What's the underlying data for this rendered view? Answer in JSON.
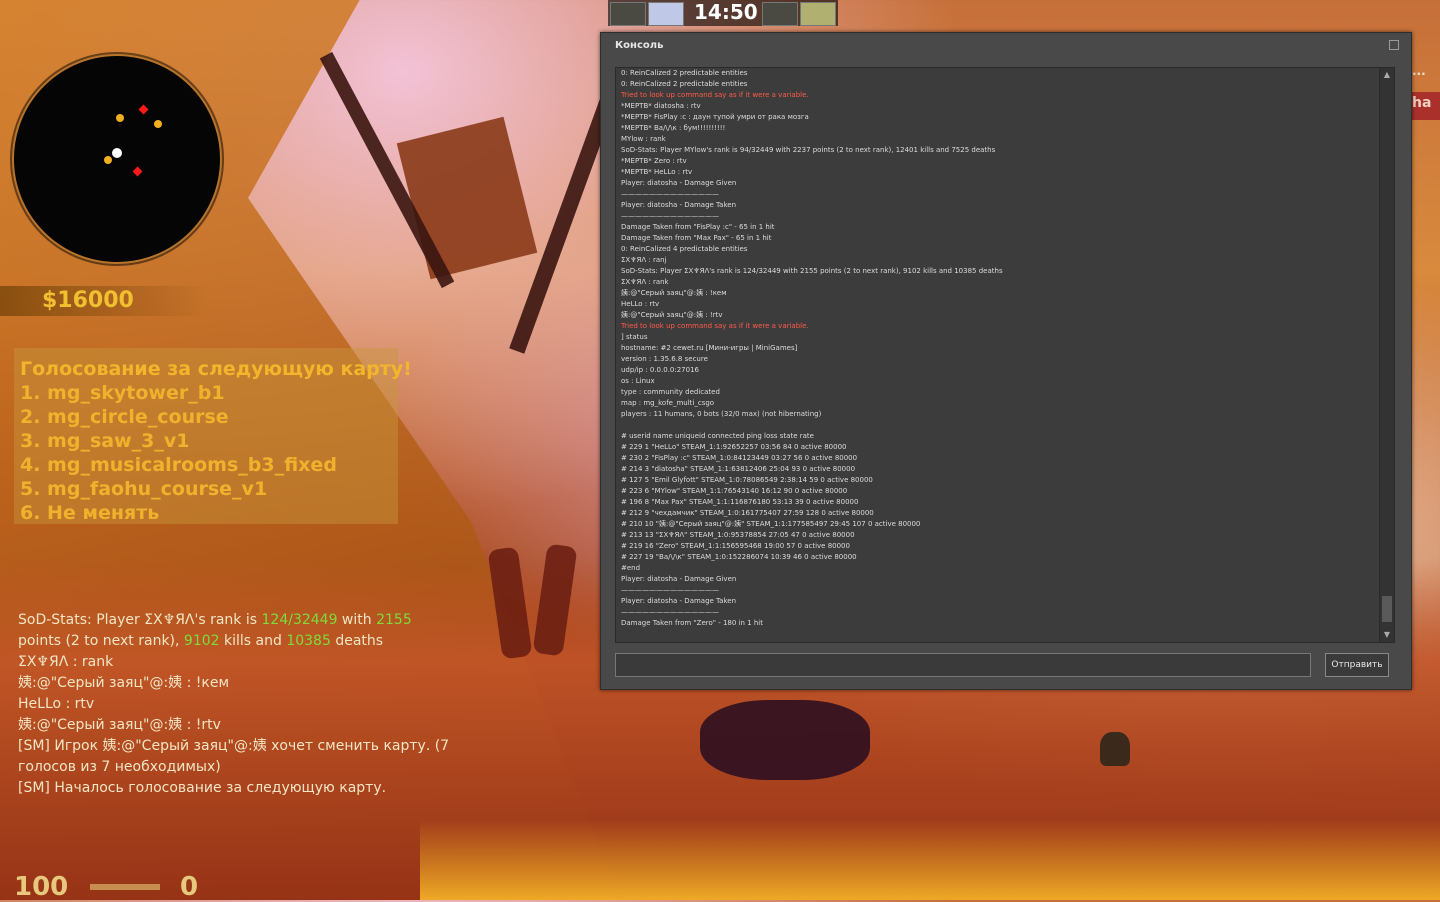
{
  "hud": {
    "money": "$16000",
    "health": "100",
    "armor": "0",
    "clock": "14:50",
    "right_edge_text": "ha",
    "right_edge_dots": "..."
  },
  "vote": {
    "title": "Голосование за следующую карту!",
    "options": [
      "1. mg_skytower_b1",
      "2. mg_circle_course",
      "3. mg_saw_3_v1",
      "4. mg_musicalrooms_b3_fixed",
      "5. mg_faohu_course_v1",
      "6. Не менять"
    ]
  },
  "chat": {
    "line1_a": "SoD-Stats: Player ΣX♆ЯΛ's rank is ",
    "line1_rank": "124/32449",
    "line1_b": " with ",
    "line1_points": "2155",
    "line2_a": "points (2 to next rank), ",
    "line2_kills": "9102",
    "line2_b": " kills and ",
    "line2_deaths": "10385",
    "line2_c": " deaths",
    "line3": "ΣX♆ЯΛ : rank",
    "line4": "姨:@\"Серый заяц\"@:姨 : !кем",
    "line5": "HeLLo : rtv",
    "line6": "姨:@\"Серый заяц\"@:姨 : !rtv",
    "line7": "[SM] Игрок 姨:@\"Серый заяц\"@:姨 хочет сменить карту. (7",
    "line8": "голосов из 7 необходимых)",
    "line9": "[SM] Началось голосование за следующую карту."
  },
  "console": {
    "title": "Консоль",
    "send_label": "Отправить",
    "lines": [
      {
        "t": "0:  ReinCalized 2 predictable entities",
        "err": false
      },
      {
        "t": "0:  ReinCalized 2 predictable entities",
        "err": false
      },
      {
        "t": "Tried to look up command say as if it were a variable.",
        "err": true
      },
      {
        "t": "*МЕРТВ* diatosha : rtv",
        "err": false
      },
      {
        "t": "*МЕРТВ* FisPlay :c : даун тупой умри от рака мозга",
        "err": false
      },
      {
        "t": "*МЕРТВ* Ba/\\/\\к : бум!!!!!!!!!!",
        "err": false
      },
      {
        "t": "MYlow : rank",
        "err": false
      },
      {
        "t": "SoD-Stats: Player MYlow's rank is 94/32449 with 2237 points (2 to next rank), 12401 kills and 7525 deaths",
        "err": false
      },
      {
        "t": "*МЕРТВ* Zero : rtv",
        "err": false
      },
      {
        "t": "*МЕРТВ* HeLLo : rtv",
        "err": false
      },
      {
        "t": "Player: diatosha - Damage Given",
        "err": false
      },
      {
        "t": "——————————————",
        "err": false
      },
      {
        "t": "Player: diatosha - Damage Taken",
        "err": false
      },
      {
        "t": "——————————————",
        "err": false
      },
      {
        "t": "Damage Taken from \"FisPlay :c\" - 65 in 1 hit",
        "err": false
      },
      {
        "t": "Damage Taken from \"Max Pax\" - 65 in 1 hit",
        "err": false
      },
      {
        "t": "0:  ReinCalized 4 predictable entities",
        "err": false
      },
      {
        "t": "ΣX♆ЯΛ : ranj",
        "err": false
      },
      {
        "t": "SoD-Stats: Player ΣX♆ЯΛ's rank is 124/32449 with 2155 points (2 to next rank), 9102 kills and 10385 deaths",
        "err": false
      },
      {
        "t": "ΣX♆ЯΛ : rank",
        "err": false
      },
      {
        "t": "姨:@\"Серый заяц\"@:姨 : !кем",
        "err": false
      },
      {
        "t": "HeLLo : rtv",
        "err": false
      },
      {
        "t": "姨:@\"Серый заяц\"@:姨 : !rtv",
        "err": false
      },
      {
        "t": "Tried to look up command say as if it were a variable.",
        "err": true
      },
      {
        "t": "] status",
        "err": false
      },
      {
        "t": "hostname: #2 cewet.ru [Мини-игры | MiniGames]",
        "err": false
      },
      {
        "t": "version : 1.35.6.8 secure",
        "err": false
      },
      {
        "t": "udp/ip  : 0.0.0.0:27016",
        "err": false
      },
      {
        "t": "os      :  Linux",
        "err": false
      },
      {
        "t": "type    :  community dedicated",
        "err": false
      },
      {
        "t": "map     :  mg_kofe_multi_csgo",
        "err": false
      },
      {
        "t": "players : 11 humans, 0 bots (32/0 max) (not hibernating)",
        "err": false
      },
      {
        "t": "",
        "err": false
      },
      {
        "t": "# userid name uniqueid connected ping loss state rate",
        "err": false
      },
      {
        "t": "# 229 1 \"HeLLo\" STEAM_1:1:92652257 03:56 84 0 active 80000",
        "err": false
      },
      {
        "t": "# 230 2 \"FisPlay :c\" STEAM_1:0:84123449 03:27 56 0 active 80000",
        "err": false
      },
      {
        "t": "# 214 3 \"diatosha\" STEAM_1:1:63812406 25:04 93 0 active 80000",
        "err": false
      },
      {
        "t": "# 127 5 \"Emil Glyfott\" STEAM_1:0:78086549  2:38:14 59 0 active 80000",
        "err": false
      },
      {
        "t": "# 223 6 \"MYlow\" STEAM_1:1:76543140 16:12 90 0 active 80000",
        "err": false
      },
      {
        "t": "# 196 8 \"Max Pax\" STEAM_1:1:116876180 53:13 39 0 active 80000",
        "err": false
      },
      {
        "t": "# 212 9 \"чехдамчик\" STEAM_1:0:161775407 27:59 128 0 active 80000",
        "err": false
      },
      {
        "t": "# 210 10 \"姨:@\"Серый заяц\"@:姨\" STEAM_1:1:177585497 29:45 107 0 active 80000",
        "err": false
      },
      {
        "t": "# 213 13 \"ΣX♆ЯΛ\" STEAM_1:0:95378854 27:05 47 0 active 80000",
        "err": false
      },
      {
        "t": "# 219 16 \"Zero\" STEAM_1:1:156595468 19:00 57 0 active 80000",
        "err": false
      },
      {
        "t": "# 227 19 \"Ba/\\/\\к\" STEAM_1:0:152286074 10:39 46 0 active 80000",
        "err": false
      },
      {
        "t": "#end",
        "err": false
      },
      {
        "t": "Player: diatosha - Damage Given",
        "err": false
      },
      {
        "t": "——————————————",
        "err": false
      },
      {
        "t": "Player: diatosha - Damage Taken",
        "err": false
      },
      {
        "t": "——————————————",
        "err": false
      },
      {
        "t": "Damage Taken from \"Zero\" - 180 in 1 hit",
        "err": false
      }
    ]
  },
  "colors": {
    "money": "#f0c030",
    "vote_text": "#f0b22d",
    "chat_highlight": "#7ddc3c",
    "error_text": "#ff5a4a",
    "console_bg": "#494949"
  }
}
